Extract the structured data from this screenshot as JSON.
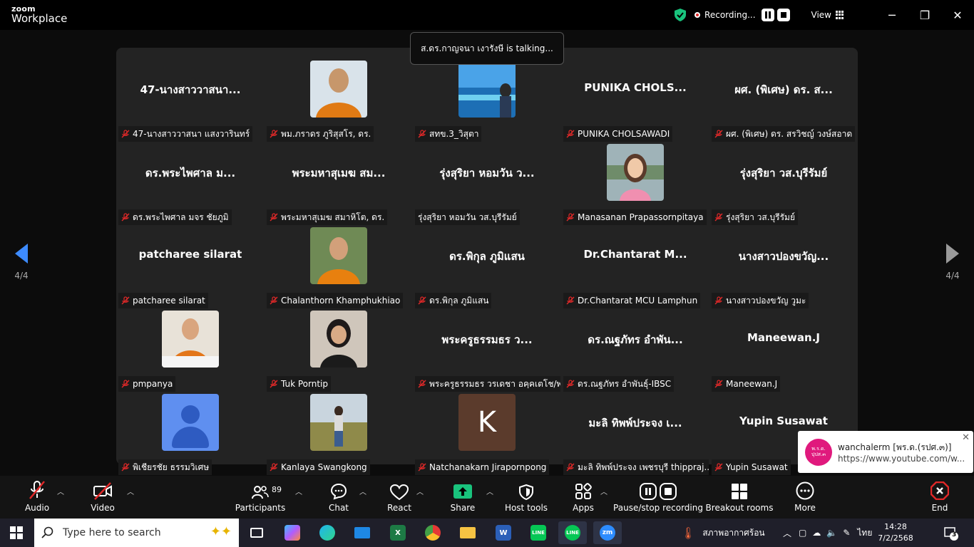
{
  "app": {
    "logo_top": "zoom",
    "logo_bottom": "Workplace"
  },
  "titlebar": {
    "recording_label": "Recording...",
    "view_label": "View",
    "minimize": "─",
    "restore": "❐",
    "close": "✕"
  },
  "talking_banner": "ส.ดร.กาญจนา เงารังษี is talking...",
  "nav": {
    "left_page": "4/4",
    "right_page": "4/4"
  },
  "tiles": [
    {
      "big": "47-นางสาววาสนา...",
      "label": "47-นางสาววาสนา แสงวารินทร์",
      "avatar": "none",
      "muted": true
    },
    {
      "big": "",
      "label": "พม.ภราดร ภูริสุสโร, ดร.",
      "avatar": "monk",
      "muted": true
    },
    {
      "big": "",
      "label": "สทข.3_วิสุตา",
      "avatar": "sea",
      "muted": true
    },
    {
      "big": "PUNIKA  CHOLS...",
      "label": "PUNIKA CHOLSAWADI",
      "avatar": "none",
      "muted": true
    },
    {
      "big": "ผศ. (พิเศษ) ดร. ส...",
      "label": "ผศ. (พิเศษ) ดร. สรวิชญ์ วงษ์สอาด",
      "avatar": "none",
      "muted": true
    },
    {
      "big": "ดร.พระไพศาล ม...",
      "label": "ดร.พระไพศาล มจร ชัยภูมิ",
      "avatar": "none",
      "muted": true
    },
    {
      "big": "พระมหาสุเมฆ สม...",
      "label": "พระมหาสุเมฆ สมาหิโต, ดร.",
      "avatar": "none",
      "muted": true
    },
    {
      "big": "รุ่งสุริยา หอมวัน ว...",
      "label": "รุ่งสุริยา หอมวัน วส.บุรีรัมย์",
      "avatar": "none",
      "muted": false
    },
    {
      "big": "",
      "label": "Manasanan Prapassornpitaya",
      "avatar": "woman",
      "muted": true
    },
    {
      "big": "รุ่งสุริยา วส.บุรีรัมย์",
      "label": "รุ่งสุริยา วส.บุรีรัมย์",
      "avatar": "none",
      "muted": true
    },
    {
      "big": "patcharee silarat",
      "label": "patcharee silarat",
      "avatar": "none",
      "muted": true
    },
    {
      "big": "",
      "label": "Chalanthorn Khamphukhiao",
      "avatar": "monk2",
      "muted": true
    },
    {
      "big": "ดร.พิกุล  ภูมิแสน",
      "label": "ดร.พิกุล  ภูมิแสน",
      "avatar": "none",
      "muted": true
    },
    {
      "big": "Dr.Chantarat  M...",
      "label": "Dr.Chantarat MCU Lamphun",
      "avatar": "none",
      "muted": true
    },
    {
      "big": "นางสาวปองขวัญ...",
      "label": "นางสาวปองขวัญ วูมะ",
      "avatar": "none",
      "muted": true
    },
    {
      "big": "",
      "label": "pmpanya",
      "avatar": "monk3",
      "muted": true
    },
    {
      "big": "",
      "label": "Tuk Porntip",
      "avatar": "woman2",
      "muted": true
    },
    {
      "big": "พระครูธรรมธร ว...",
      "label": "พระครูธรรมธร วรเดชา อคฺคเตโช/พ...",
      "avatar": "none",
      "muted": true
    },
    {
      "big": "ดร.ณฐภัทร อำพัน...",
      "label": "ดร.ณฐภัทร อำพันธุ์-IBSC",
      "avatar": "none",
      "muted": true
    },
    {
      "big": "Maneewan.J",
      "label": "Maneewan.J",
      "avatar": "none",
      "muted": true
    },
    {
      "big": "",
      "label": "พิเชียรชัย ธรรมวิเศษ",
      "avatar": "default",
      "muted": true
    },
    {
      "big": "",
      "label": "Kanlaya Swangkong",
      "avatar": "field",
      "muted": true
    },
    {
      "big": "",
      "label": "Natchanakarn Jirapornpong",
      "avatar": "K",
      "muted": true
    },
    {
      "big": "มะลิ ทิพพ์ประจง เ...",
      "label": "มะลิ ทิพพ์ประจง เพชรบุรี thippraj...",
      "avatar": "none",
      "muted": true
    },
    {
      "big": "Yupin Susawat",
      "label": "Yupin Susawat",
      "avatar": "none",
      "muted": true
    }
  ],
  "notification": {
    "logo_text": "พ.ร.ด.\nปุปส.๓",
    "title": "wanchalerm [พร.ด.(รปศ.๓)]",
    "url": "https://www.youtube.com/w..."
  },
  "toolbar": {
    "audio": "Audio",
    "video": "Video",
    "participants": "Participants",
    "participants_count": "89",
    "chat": "Chat",
    "react": "React",
    "share": "Share",
    "host_tools": "Host tools",
    "apps": "Apps",
    "pause_recording": "Pause/stop recording",
    "breakout": "Breakout rooms",
    "more": "More",
    "end": "End"
  },
  "taskbar": {
    "search_placeholder": "Type here to search",
    "weather": "สภาพอากาศร้อน",
    "lang": "ไทย",
    "time": "14:28",
    "date": "7/2/2568",
    "notif_count": "3"
  },
  "colors": {
    "accent_green": "#19c37d",
    "record_red": "#e02828",
    "end_red": "#e02828"
  }
}
